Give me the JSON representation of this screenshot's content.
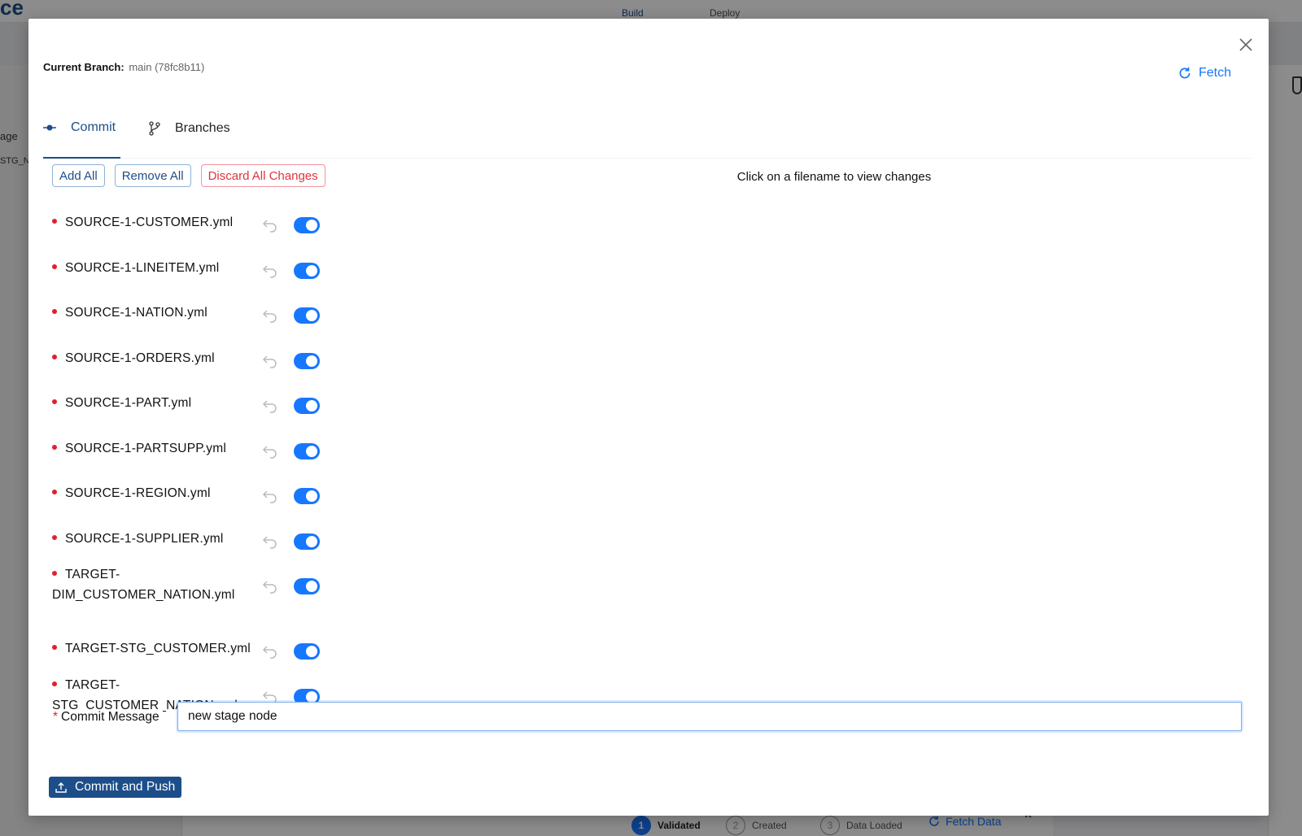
{
  "background": {
    "logo_text": "ce",
    "nav": [
      "Build",
      "Deploy"
    ],
    "left_texts": [
      "age",
      "STG_N"
    ],
    "steps": [
      {
        "num": "1",
        "label": "Validated"
      },
      {
        "num": "2",
        "label": "Created"
      },
      {
        "num": "3",
        "label": "Data Loaded"
      }
    ],
    "fetch_data_label": "Fetch Data"
  },
  "modal": {
    "branch_label": "Current Branch:",
    "branch_value": "main (78fc8b11)",
    "fetch_label": "Fetch",
    "tabs": [
      {
        "label": "Commit",
        "icon": "commit-icon",
        "active": true
      },
      {
        "label": "Branches",
        "icon": "branch-icon",
        "active": false
      }
    ],
    "actions": {
      "add_all": "Add All",
      "remove_all": "Remove All",
      "discard_all": "Discard All Changes"
    },
    "hint": "Click on a filename to view changes",
    "files": [
      {
        "name": "SOURCE-1-CUSTOMER.yml",
        "staged": true
      },
      {
        "name": "SOURCE-1-LINEITEM.yml",
        "staged": true
      },
      {
        "name": "SOURCE-1-NATION.yml",
        "staged": true
      },
      {
        "name": "SOURCE-1-ORDERS.yml",
        "staged": true
      },
      {
        "name": "SOURCE-1-PART.yml",
        "staged": true
      },
      {
        "name": "SOURCE-1-PARTSUPP.yml",
        "staged": true
      },
      {
        "name": "SOURCE-1-REGION.yml",
        "staged": true
      },
      {
        "name": "SOURCE-1-SUPPLIER.yml",
        "staged": true
      },
      {
        "name": "TARGET-DIM_CUSTOMER_NATION.yml",
        "staged": true
      },
      {
        "name": "TARGET-STG_CUSTOMER.yml",
        "staged": true
      },
      {
        "name": "TARGET-STG_CUSTOMER_NATION.yml",
        "staged": true
      }
    ],
    "commit_message_label": "Commit Message",
    "commit_message_value": "new stage node",
    "commit_button": "Commit and Push",
    "colors": {
      "accent": "#1677ff",
      "primary": "#1d4e89",
      "danger": "#e0323f",
      "modified_dot": "#e41e2b"
    }
  }
}
